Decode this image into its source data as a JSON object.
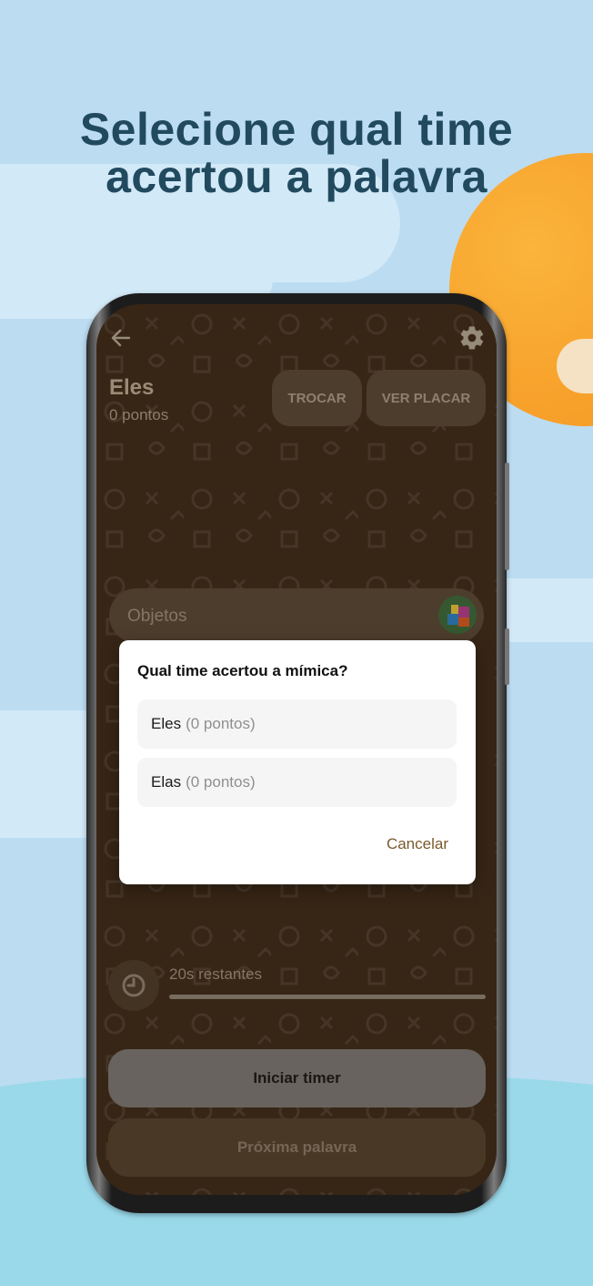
{
  "headline": {
    "line1": "Selecione qual time",
    "line2": "acertou a palavra"
  },
  "app": {
    "team": {
      "name": "Eles",
      "points": "0 pontos"
    },
    "buttons": {
      "swap": "TROCAR",
      "scoreboard": "VER PLACAR"
    },
    "category": {
      "label": "Objetos"
    },
    "timer": {
      "label": "20s restantes"
    },
    "actions": {
      "start_timer": "Iniciar timer",
      "next_word": "Próxima palavra"
    }
  },
  "dialog": {
    "title": "Qual time acertou a mímica?",
    "options": [
      {
        "name": "Eles",
        "points": "(0 pontos)"
      },
      {
        "name": "Elas",
        "points": "(0 pontos)"
      }
    ],
    "cancel": "Cancelar"
  },
  "colors": {
    "headline": "#224a5f",
    "sky": "#bcdcf1",
    "sun": "#f7a12a",
    "screen_bg": "#3f2d1a",
    "dialog_bg": "#ffffff",
    "cancel_text": "#7a5a2c"
  },
  "icons": [
    "back-arrow-icon",
    "gear-icon",
    "category-objects-icon",
    "clock-icon"
  ]
}
